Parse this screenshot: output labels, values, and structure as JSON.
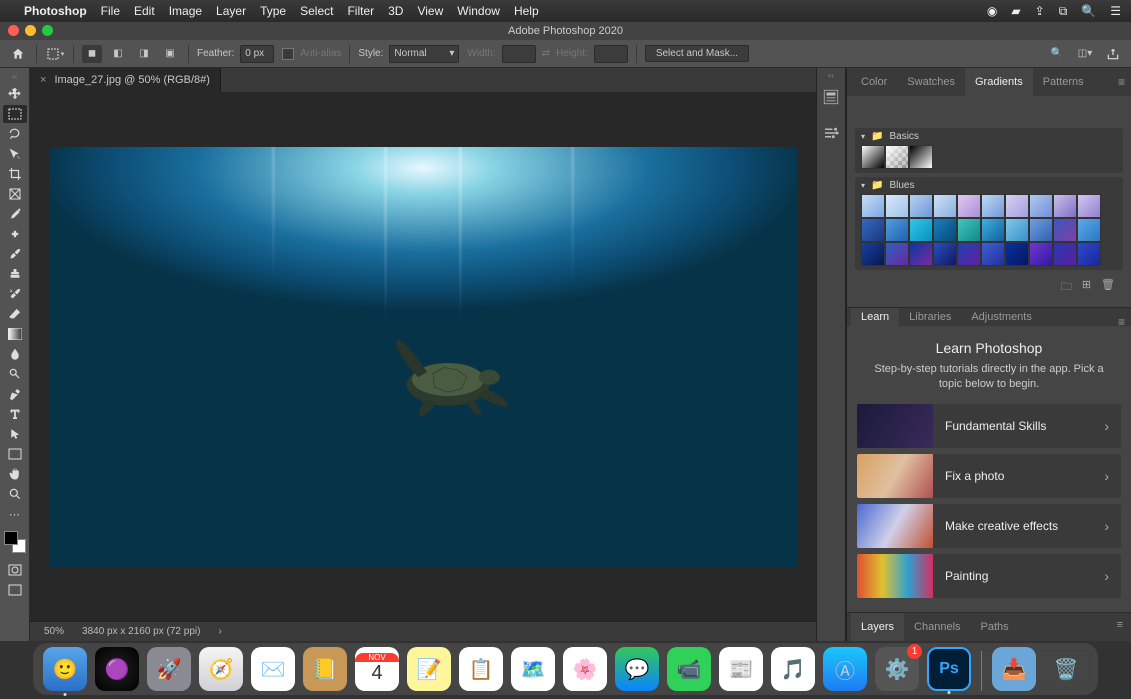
{
  "mac_menu": {
    "app": "Photoshop",
    "items": [
      "File",
      "Edit",
      "Image",
      "Layer",
      "Type",
      "Select",
      "Filter",
      "3D",
      "View",
      "Window",
      "Help"
    ]
  },
  "window": {
    "title": "Adobe Photoshop 2020"
  },
  "optionbar": {
    "feather_label": "Feather:",
    "feather_value": "0 px",
    "antialias": "Anti-alias",
    "style_label": "Style:",
    "style_value": "Normal",
    "width_label": "Width:",
    "height_label": "Height:",
    "select_mask": "Select and Mask..."
  },
  "document": {
    "tab_title": "Image_27.jpg @ 50% (RGB/8#)",
    "zoom": "50%",
    "info": "3840 px x 2160 px (72 ppi)"
  },
  "tools": [
    "move",
    "marquee",
    "lasso",
    "quick-select",
    "crop",
    "frame",
    "eyedropper",
    "heal",
    "brush",
    "stamp",
    "history-brush",
    "eraser",
    "gradient",
    "blur",
    "dodge",
    "pen",
    "type",
    "path-select",
    "rectangle",
    "hand",
    "zoom",
    "ellipsis"
  ],
  "panels": {
    "top_tabs": [
      "Color",
      "Swatches",
      "Gradients",
      "Patterns"
    ],
    "top_active": "Gradients",
    "gradients": {
      "group1": "Basics",
      "group2": "Blues"
    },
    "mid_tabs": [
      "Learn",
      "Libraries",
      "Adjustments"
    ],
    "mid_active": "Learn",
    "learn": {
      "title": "Learn Photoshop",
      "desc": "Step-by-step tutorials directly in the app. Pick a topic below to begin.",
      "items": [
        "Fundamental Skills",
        "Fix a photo",
        "Make creative effects",
        "Painting"
      ]
    },
    "bottom_tabs": [
      "Layers",
      "Channels",
      "Paths"
    ],
    "bottom_active": "Layers"
  },
  "dock": {
    "date_month": "NOV",
    "date_day": "4",
    "sysprefs_badge": "1"
  }
}
